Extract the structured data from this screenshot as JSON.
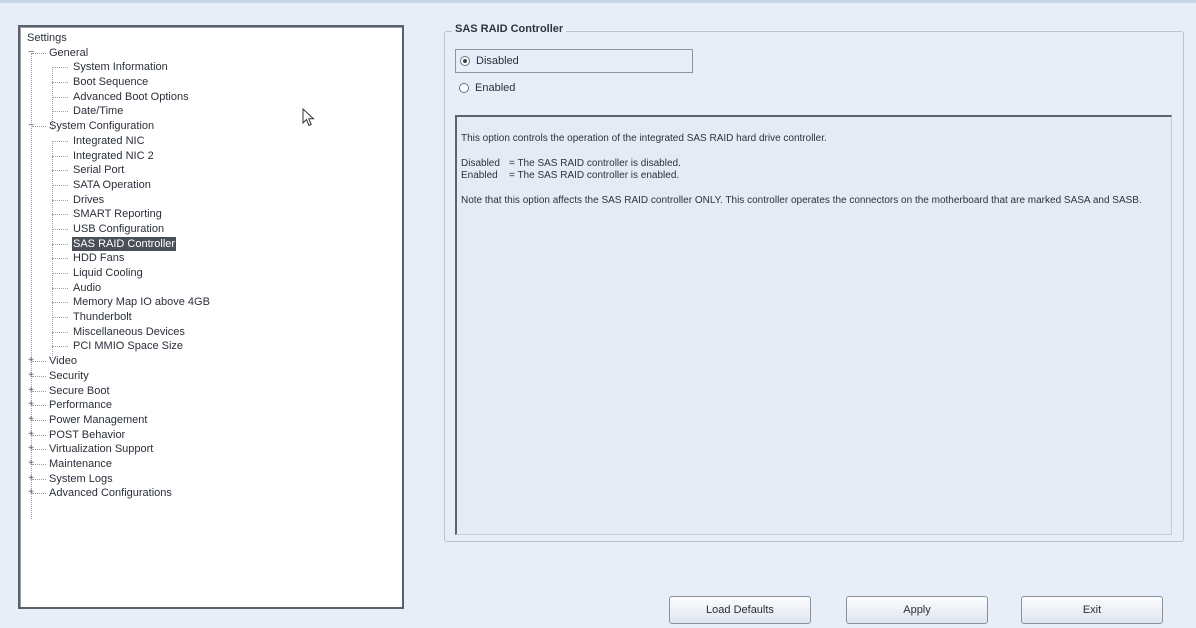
{
  "tree": {
    "items": [
      {
        "label": "Settings",
        "level": 0,
        "expander": ""
      },
      {
        "label": "General",
        "level": 1,
        "expander": "−"
      },
      {
        "label": "System Information",
        "level": 2
      },
      {
        "label": "Boot Sequence",
        "level": 2
      },
      {
        "label": "Advanced Boot Options",
        "level": 2
      },
      {
        "label": "Date/Time",
        "level": 2
      },
      {
        "label": "System Configuration",
        "level": 1,
        "expander": "−"
      },
      {
        "label": "Integrated NIC",
        "level": 2
      },
      {
        "label": "Integrated NIC 2",
        "level": 2
      },
      {
        "label": "Serial Port",
        "level": 2
      },
      {
        "label": "SATA Operation",
        "level": 2
      },
      {
        "label": "Drives",
        "level": 2
      },
      {
        "label": "SMART Reporting",
        "level": 2
      },
      {
        "label": "USB Configuration",
        "level": 2
      },
      {
        "label": "SAS RAID Controller",
        "level": 2,
        "selected": true
      },
      {
        "label": "HDD Fans",
        "level": 2
      },
      {
        "label": "Liquid Cooling",
        "level": 2
      },
      {
        "label": "Audio",
        "level": 2
      },
      {
        "label": "Memory Map IO above 4GB",
        "level": 2
      },
      {
        "label": "Thunderbolt",
        "level": 2
      },
      {
        "label": "Miscellaneous Devices",
        "level": 2
      },
      {
        "label": "PCI MMIO Space Size",
        "level": 2
      },
      {
        "label": "Video",
        "level": 1,
        "expander": "+"
      },
      {
        "label": "Security",
        "level": 1,
        "expander": "+"
      },
      {
        "label": "Secure Boot",
        "level": 1,
        "expander": "+"
      },
      {
        "label": "Performance",
        "level": 1,
        "expander": "+"
      },
      {
        "label": "Power Management",
        "level": 1,
        "expander": "+"
      },
      {
        "label": "POST Behavior",
        "level": 1,
        "expander": "+"
      },
      {
        "label": "Virtualization Support",
        "level": 1,
        "expander": "+"
      },
      {
        "label": "Maintenance",
        "level": 1,
        "expander": "+"
      },
      {
        "label": "System Logs",
        "level": 1,
        "expander": "+"
      },
      {
        "label": "Advanced Configurations",
        "level": 1,
        "expander": "+"
      }
    ]
  },
  "panel": {
    "title": "SAS RAID Controller",
    "options": [
      {
        "label": "Disabled",
        "checked": true
      },
      {
        "label": "Enabled",
        "checked": false
      }
    ]
  },
  "description": {
    "intro": "This option controls the operation of the integrated SAS RAID hard drive controller.",
    "rows": [
      {
        "key": "Disabled",
        "value": "= The SAS RAID controller is disabled."
      },
      {
        "key": "Enabled",
        "value": "= The SAS RAID controller is enabled."
      }
    ],
    "note": "Note that this option affects the SAS RAID controller ONLY.  This controller operates the connectors on the motherboard that are marked SASA and SASB."
  },
  "buttons": {
    "load_defaults": "Load Defaults",
    "apply": "Apply",
    "exit": "Exit"
  }
}
